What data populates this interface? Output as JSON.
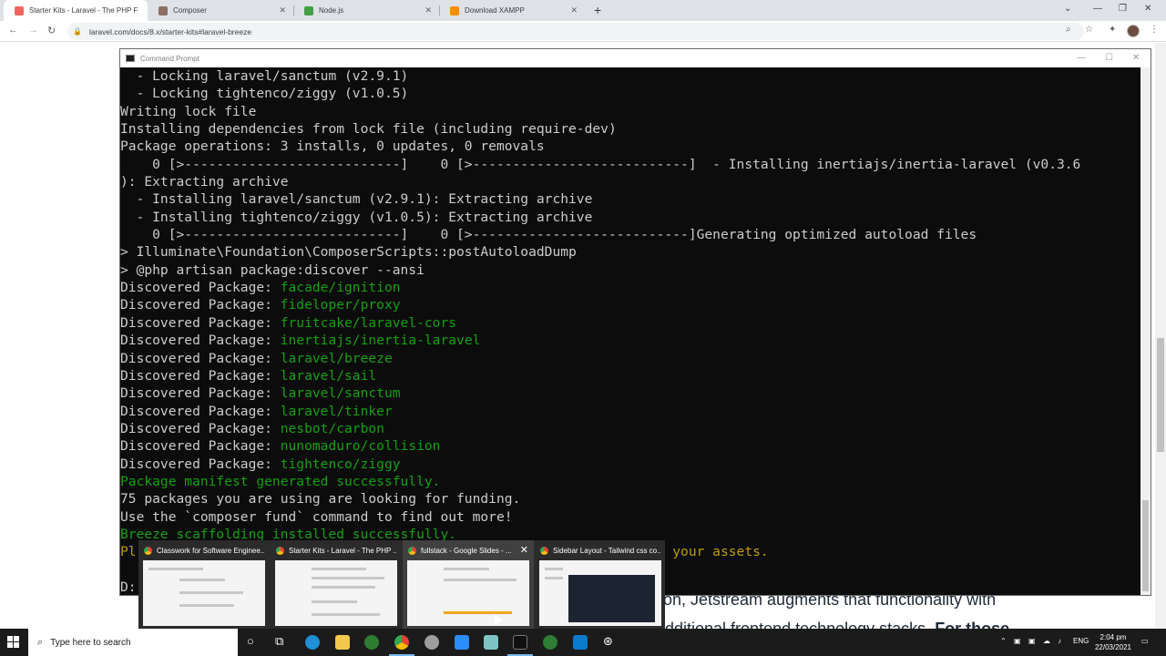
{
  "browser": {
    "tabs": [
      {
        "label": "Starter Kits - Laravel - The PHP F",
        "color": "#f4645f"
      },
      {
        "label": "Composer",
        "color": "#8d6e63"
      },
      {
        "label": "Node.js",
        "color": "#43a047"
      },
      {
        "label": "Download XAMPP",
        "color": "#fb8c00"
      }
    ],
    "url": "laravel.com/docs/8.x/starter-kits#laravel-breeze"
  },
  "page": {
    "line1": "on, Jetstream augments that functionality with",
    "line2_pre": "dditional frontend technology stacks. ",
    "line2_bold": "For those"
  },
  "cmd": {
    "title": "Command Prompt",
    "lines": [
      {
        "parts": [
          {
            "t": "  - Locking laravel/sanctum (v2.9.1)",
            "c": ""
          }
        ]
      },
      {
        "parts": [
          {
            "t": "  - Locking tightenco/ziggy (v1.0.5)",
            "c": ""
          }
        ]
      },
      {
        "parts": [
          {
            "t": "Writing lock file",
            "c": ""
          }
        ]
      },
      {
        "parts": [
          {
            "t": "Installing dependencies from lock file (including require-dev)",
            "c": ""
          }
        ]
      },
      {
        "parts": [
          {
            "t": "Package operations: 3 installs, 0 updates, 0 removals",
            "c": ""
          }
        ]
      },
      {
        "parts": [
          {
            "t": "    0 [>---------------------------]    0 [>---------------------------]  - Installing inertiajs/inertia-laravel (v0.3.6",
            "c": ""
          }
        ]
      },
      {
        "parts": [
          {
            "t": "): Extracting archive",
            "c": ""
          }
        ]
      },
      {
        "parts": [
          {
            "t": "  - Installing laravel/sanctum (v2.9.1): Extracting archive",
            "c": ""
          }
        ]
      },
      {
        "parts": [
          {
            "t": "  - Installing tightenco/ziggy (v1.0.5): Extracting archive",
            "c": ""
          }
        ]
      },
      {
        "parts": [
          {
            "t": "    0 [>---------------------------]    0 [>---------------------------]Generating optimized autoload files",
            "c": ""
          }
        ]
      },
      {
        "parts": [
          {
            "t": "> Illuminate\\Foundation\\ComposerScripts::postAutoloadDump",
            "c": ""
          }
        ]
      },
      {
        "parts": [
          {
            "t": "> @php artisan package:discover --ansi",
            "c": ""
          }
        ]
      },
      {
        "parts": [
          {
            "t": "Discovered Package: ",
            "c": ""
          },
          {
            "t": "facade/ignition",
            "c": "g"
          }
        ]
      },
      {
        "parts": [
          {
            "t": "Discovered Package: ",
            "c": ""
          },
          {
            "t": "fideloper/proxy",
            "c": "g"
          }
        ]
      },
      {
        "parts": [
          {
            "t": "Discovered Package: ",
            "c": ""
          },
          {
            "t": "fruitcake/laravel-cors",
            "c": "g"
          }
        ]
      },
      {
        "parts": [
          {
            "t": "Discovered Package: ",
            "c": ""
          },
          {
            "t": "inertiajs/inertia-laravel",
            "c": "g"
          }
        ]
      },
      {
        "parts": [
          {
            "t": "Discovered Package: ",
            "c": ""
          },
          {
            "t": "laravel/breeze",
            "c": "g"
          }
        ]
      },
      {
        "parts": [
          {
            "t": "Discovered Package: ",
            "c": ""
          },
          {
            "t": "laravel/sail",
            "c": "g"
          }
        ]
      },
      {
        "parts": [
          {
            "t": "Discovered Package: ",
            "c": ""
          },
          {
            "t": "laravel/sanctum",
            "c": "g"
          }
        ]
      },
      {
        "parts": [
          {
            "t": "Discovered Package: ",
            "c": ""
          },
          {
            "t": "laravel/tinker",
            "c": "g"
          }
        ]
      },
      {
        "parts": [
          {
            "t": "Discovered Package: ",
            "c": ""
          },
          {
            "t": "nesbot/carbon",
            "c": "g"
          }
        ]
      },
      {
        "parts": [
          {
            "t": "Discovered Package: ",
            "c": ""
          },
          {
            "t": "nunomaduro/collision",
            "c": "g"
          }
        ]
      },
      {
        "parts": [
          {
            "t": "Discovered Package: ",
            "c": ""
          },
          {
            "t": "tightenco/ziggy",
            "c": "g"
          }
        ]
      },
      {
        "parts": [
          {
            "t": "Package manifest generated successfully.",
            "c": "g"
          }
        ]
      },
      {
        "parts": [
          {
            "t": "75 packages you are using are looking for funding.",
            "c": ""
          }
        ]
      },
      {
        "parts": [
          {
            "t": "Use the `composer fund` command to find out more!",
            "c": ""
          }
        ]
      },
      {
        "parts": [
          {
            "t": "Breeze scaffolding installed successfully.",
            "c": "g"
          }
        ]
      },
      {
        "parts": [
          {
            "t": "Pl",
            "c": "y"
          },
          {
            "t": "                                                                   your assets.",
            "c": "y"
          }
        ]
      },
      {
        "parts": [
          {
            "t": "",
            "c": ""
          }
        ]
      },
      {
        "parts": [
          {
            "t": "D:",
            "c": ""
          }
        ]
      }
    ]
  },
  "thumbnails": [
    {
      "label": "Classwork for Software Enginee..."
    },
    {
      "label": "Starter Kits - Laravel - The PHP ..."
    },
    {
      "label": "fullstack - Google Slides - ..."
    },
    {
      "label": "Sidebar Layout - Tailwind css co..."
    }
  ],
  "taskbar": {
    "search_placeholder": "Type here to search",
    "language": "ENG",
    "time": "2:04 pm",
    "date": "22/03/2021"
  }
}
